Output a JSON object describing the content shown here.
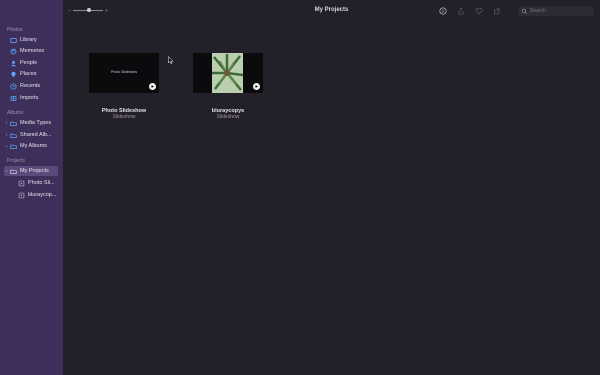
{
  "window": {
    "title": "My Projects"
  },
  "toolbar": {
    "zoom_slider_level": 0.5,
    "search_placeholder": "Search"
  },
  "sidebar": {
    "sections": [
      {
        "header": "Photos"
      },
      {
        "header": "Albums"
      },
      {
        "header": "Projects"
      }
    ],
    "items": [
      {
        "label": "Library",
        "icon": "library-icon"
      },
      {
        "label": "Memories",
        "icon": "memories-icon"
      },
      {
        "label": "People",
        "icon": "people-icon"
      },
      {
        "label": "Places",
        "icon": "places-icon"
      },
      {
        "label": "Recents",
        "icon": "recents-icon"
      },
      {
        "label": "Imports",
        "icon": "imports-icon"
      },
      {
        "label": "Media Types",
        "icon": "folder-icon"
      },
      {
        "label": "Shared Alb...",
        "icon": "folder-icon"
      },
      {
        "label": "My Albums",
        "icon": "folder-icon"
      },
      {
        "label": "My Projects",
        "icon": "folder-icon",
        "selected": true
      },
      {
        "label": "Photo Sli...",
        "icon": "slideshow-icon"
      },
      {
        "label": "bluraycop...",
        "icon": "slideshow-icon"
      }
    ]
  },
  "projects": [
    {
      "name": "Photo Slideshow",
      "type": "Slideshow",
      "thumb_text": "Photo Slideshow"
    },
    {
      "name": "bluraycopys",
      "type": "Slideshow",
      "thumb_text": ""
    }
  ],
  "colors": {
    "sidebar_bg": "#3d2f5a",
    "content_bg": "#232029",
    "accent": "#5aa8ff",
    "selection": "#5a4a7c"
  }
}
